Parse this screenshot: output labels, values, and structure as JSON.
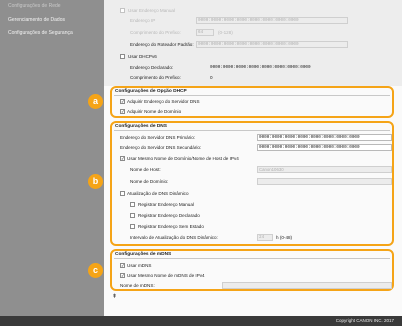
{
  "sidebar": {
    "items": [
      {
        "label": "Configurações de Rede"
      },
      {
        "label": "Gerenciamento de Dados"
      },
      {
        "label": "Configurações de Segurança"
      }
    ]
  },
  "ipv6": {
    "manual_checkbox_label": "Usar Endereço Manual",
    "ip_label": "Endereço IP",
    "ip_value": "0000:0000:0000:0000:0000:0000:0000:0000",
    "prefix_label": "Comprimento do Prefixo:",
    "prefix_value": "64",
    "prefix_range": "(0-128)",
    "router_label": "Endereço do Roteador Padrão:",
    "router_value": "0000:0000:0000:0000:0000:0000:0000:0000",
    "dhcpv6_label": "Usar DHCPv6",
    "declared_label": "Endereço Declarado:",
    "declared_value": "0000:0000:0000:0000:0000:0000:0000:0000",
    "declared_prefix_label": "Comprimento do Prefixo:",
    "declared_prefix_value": "0"
  },
  "dhcp_section": {
    "title": "Configurações de Opção DHCP",
    "badge": "a",
    "acquire_dns_label": "Adquirir Endereço do Servidor DNS",
    "acquire_domain_label": "Adquirir Nome de Domínio"
  },
  "dns_section": {
    "title": "Configurações de DNS",
    "badge": "b",
    "primary_label": "Endereço do Servidor DNS Primário:",
    "primary_value": "0000:0000:0000:0000:0000:0000:0000:0000",
    "secondary_label": "Endereço do Servidor DNS Secundário:",
    "secondary_value": "0000:0000:0000:0000:0000:0000:0000:0000",
    "same_name_label": "Usar Mesmo Nome de Domínio/Nome de Host de IPv4",
    "host_label": "Nome de Host:",
    "host_value": "Canon10630",
    "domain_label": "Nome de Domínio:",
    "domain_value": "",
    "dynamic_update_label": "Atualização de DNS Dinâmico",
    "register_manual_label": "Registrar Endereço Manual",
    "register_declared_label": "Registrar Endereço Declarado",
    "register_stateless_label": "Registrar Endereço Sem Estado",
    "interval_label": "Intervalo de Atualização do DNS Dinâmico:",
    "interval_value": "24",
    "interval_unit": "h (0-48)"
  },
  "mdns_section": {
    "title": "Configurações de mDNS",
    "badge": "c",
    "use_mdns_label": "Usar mDNS",
    "same_name_label": "Usar Mesmo Nome de mDNS de IPv4",
    "mdns_name_label": "Nome de mDNS:",
    "mdns_name_value": ""
  },
  "footer": {
    "copyright": "Copyright CANON INC. 2017"
  },
  "colors": {
    "accent": "#f5a417",
    "footer_bg": "#3a3a3a"
  }
}
